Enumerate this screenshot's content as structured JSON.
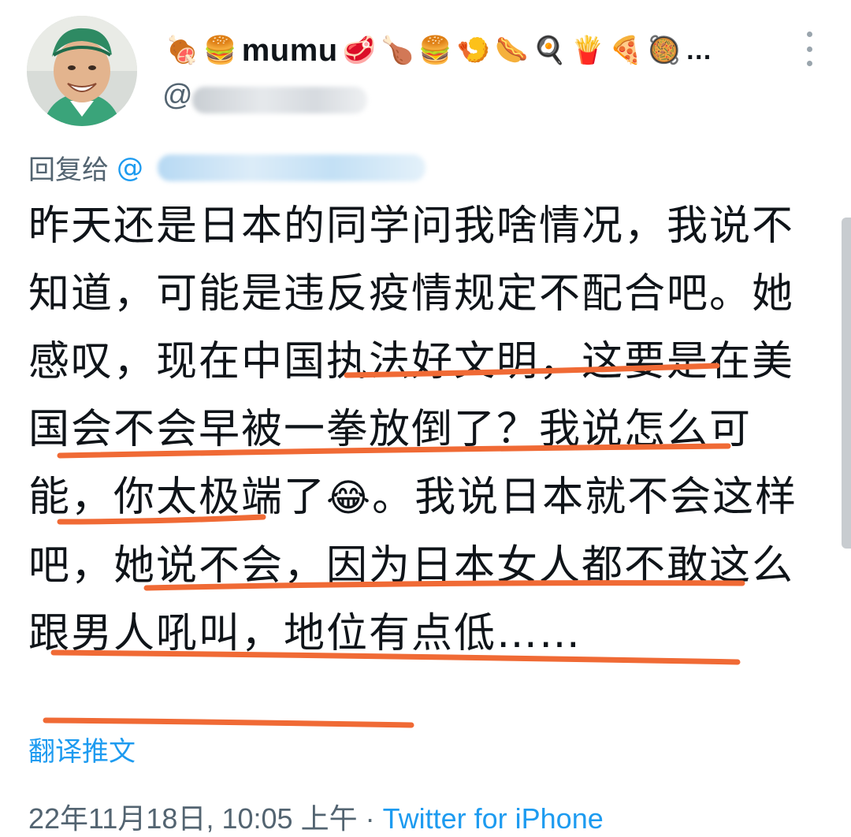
{
  "author": {
    "display_name": "mumu",
    "emoji_prefix": [
      "🍖",
      "🍔"
    ],
    "emoji_suffix": [
      "🥩",
      "🍗",
      "🍔",
      "🍤",
      "🌭",
      "🍳",
      "🍟",
      "🍕",
      "🥘"
    ],
    "name_truncation": "…",
    "handle_prefix": "@"
  },
  "reply": {
    "label": "回复给",
    "at": "@"
  },
  "tweet": {
    "segments": [
      "昨天还是日本的同学问我啥情况，我说不知道，可能是违反疫情规定不配合吧。她感叹，",
      "现在中国执法好文明，这要是在美国会不会早被一拳放倒了？我说",
      "怎么可能，你太极端了",
      "😂",
      "。",
      "我说日本就不会这样吧，她说不会，因为日本女人都不敢这么跟男人吼叫，地位有点低",
      "……"
    ]
  },
  "translate_label": "翻译推文",
  "meta": {
    "date": "22年11月18日",
    "time": "10:05 上午",
    "separator": "·",
    "source": "Twitter for iPhone"
  },
  "colors": {
    "link": "#1d9bf0",
    "secondary_text": "#536471",
    "underline_annotation": "#f06a35"
  }
}
